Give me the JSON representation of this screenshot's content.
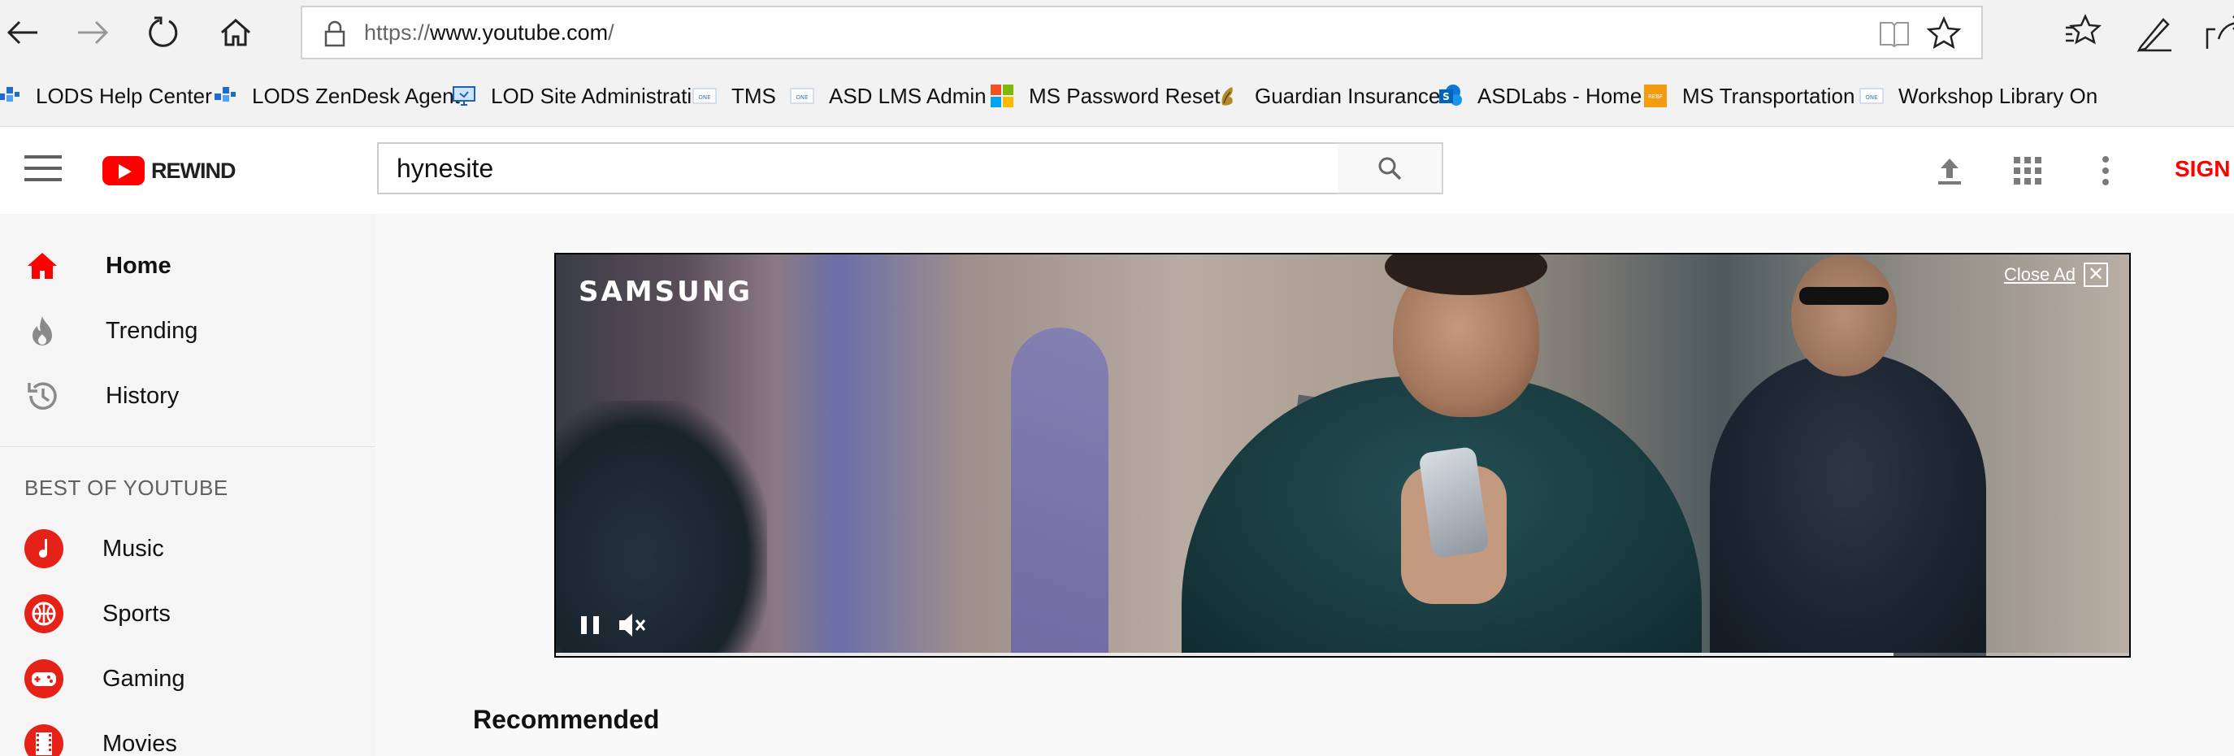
{
  "browser": {
    "url_prefix": "https://",
    "url_host": "www.youtube.com",
    "url_path": "/",
    "favorites": [
      {
        "label": "LODS Help Center",
        "icon": "lods-icon"
      },
      {
        "label": "LODS ZenDesk Agent",
        "icon": "lods-icon"
      },
      {
        "label": "LOD Site Administrati",
        "icon": "monitor-icon"
      },
      {
        "label": "TMS",
        "icon": "onenote-icon"
      },
      {
        "label": "ASD LMS Admin",
        "icon": "onenote-icon"
      },
      {
        "label": "MS Password Reset",
        "icon": "microsoft-icon"
      },
      {
        "label": "Guardian Insurance",
        "icon": "guardian-icon"
      },
      {
        "label": "ASDLabs - Home",
        "icon": "sharepoint-icon"
      },
      {
        "label": "MS Transportation",
        "icon": "transport-icon"
      },
      {
        "label": "Workshop Library On",
        "icon": "onenote-icon"
      }
    ]
  },
  "youtube": {
    "logo_text": "REWIND",
    "search_value": "hynesite",
    "signin_label": "SIGN",
    "sidebar": {
      "main_items": [
        {
          "label": "Home",
          "icon": "home-icon",
          "active": true
        },
        {
          "label": "Trending",
          "icon": "fire-icon",
          "active": false
        },
        {
          "label": "History",
          "icon": "history-icon",
          "active": false
        }
      ],
      "section_heading": "BEST OF YOUTUBE",
      "categories": [
        {
          "label": "Music",
          "icon": "music-icon"
        },
        {
          "label": "Sports",
          "icon": "sports-icon"
        },
        {
          "label": "Gaming",
          "icon": "gaming-icon"
        },
        {
          "label": "Movies",
          "icon": "movies-icon"
        }
      ]
    },
    "ad": {
      "brand": "SAMSUNG",
      "close_label": "Close Ad",
      "close_symbol": "✕",
      "progress": 0.85
    },
    "recommended_heading": "Recommended"
  },
  "colors": {
    "brand_red": "#ff0000",
    "category_red": "#e62117"
  }
}
